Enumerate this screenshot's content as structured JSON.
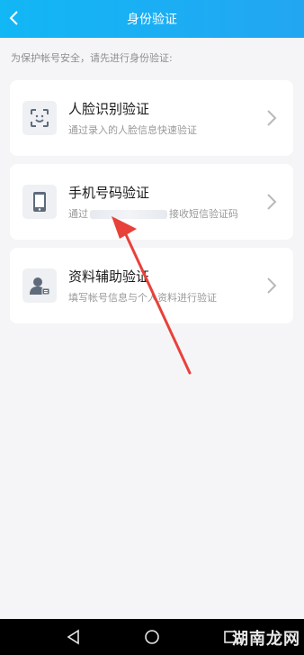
{
  "header": {
    "title": "身份验证",
    "back_icon": "chevron-left-icon"
  },
  "hint": "为保护帐号安全，请先进行身份验证:",
  "options": [
    {
      "title": "人脸识别验证",
      "desc": "通过录入的人脸信息快速验证",
      "icon": "face-scan-icon"
    },
    {
      "title": "手机号码验证",
      "desc_prefix": "通过",
      "desc_suffix": "接收短信验证码",
      "icon": "mobile-phone-icon"
    },
    {
      "title": "资料辅助验证",
      "desc": "填写帐号信息与个人资料进行验证",
      "icon": "profile-card-icon"
    }
  ],
  "navbar": {
    "back": "triangle-back-icon",
    "home": "circle-home-icon",
    "recents": "square-recents-icon"
  },
  "watermark": "湖南龙网",
  "colors": {
    "header_start": "#12b7f5",
    "header_end": "#23a6f2",
    "arrow": "#e8413a"
  }
}
